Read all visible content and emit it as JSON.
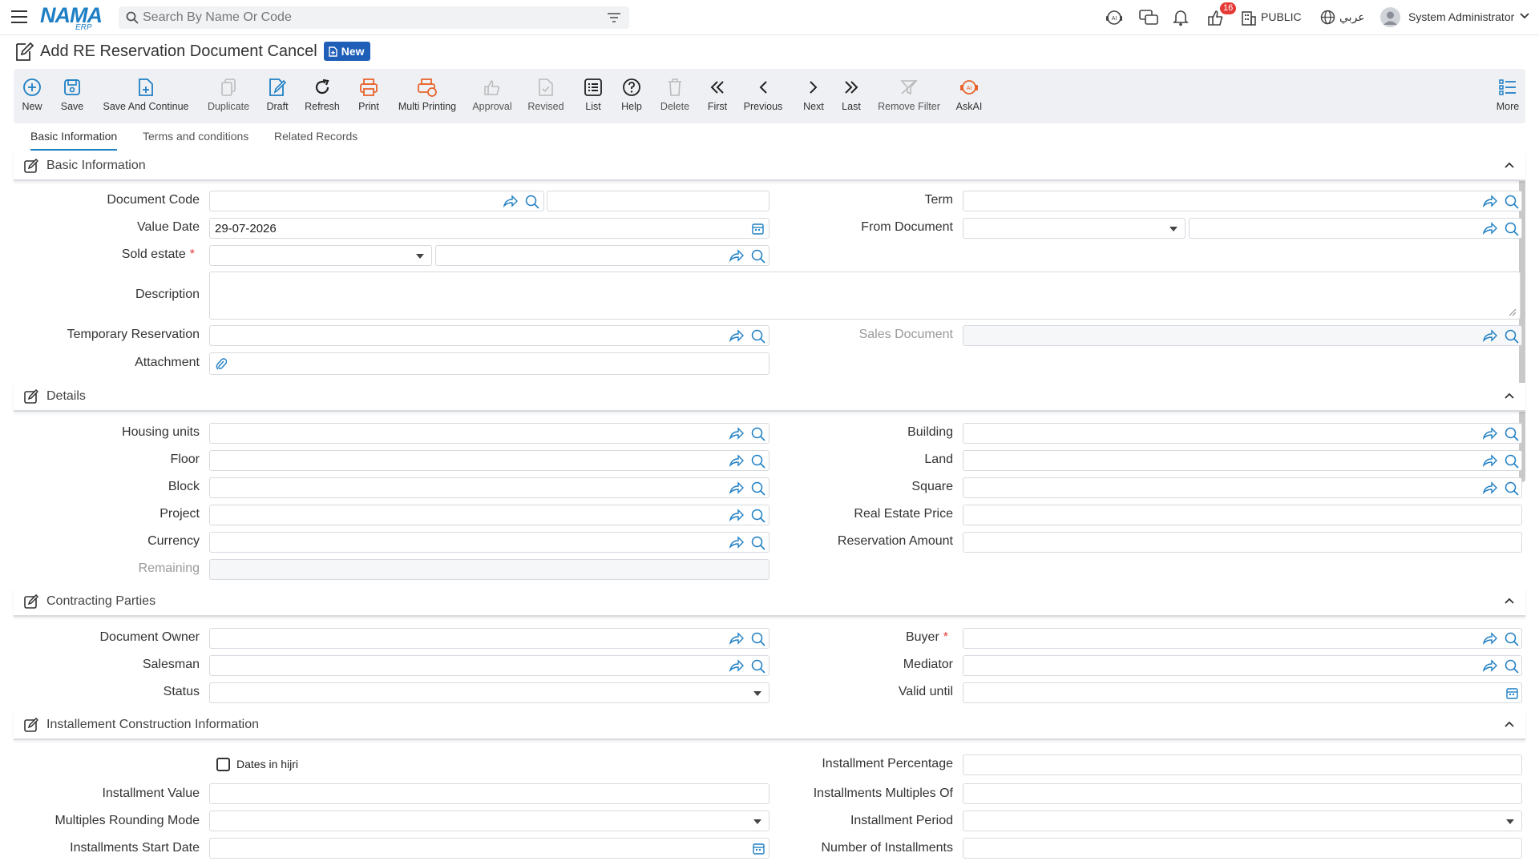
{
  "app": {
    "logo_text": "NAMA",
    "logo_sub": "ERP"
  },
  "search": {
    "placeholder": "Search By Name Or Code"
  },
  "topbar": {
    "notification_count": "16",
    "company": "PUBLIC",
    "language": "عربي",
    "user": "System Administrator"
  },
  "page": {
    "title": "Add RE Reservation Document Cancel",
    "status_badge": "New"
  },
  "toolbar": {
    "new": "New",
    "save": "Save",
    "save_continue": "Save And Continue",
    "duplicate": "Duplicate",
    "draft": "Draft",
    "refresh": "Refresh",
    "print": "Print",
    "multi_printing": "Multi Printing",
    "approval": "Approval",
    "revised": "Revised",
    "list": "List",
    "help": "Help",
    "delete": "Delete",
    "first": "First",
    "previous": "Previous",
    "next": "Next",
    "last": "Last",
    "remove_filter": "Remove Filter",
    "askai": "AskAI",
    "more": "More"
  },
  "tabs": {
    "basic": "Basic Information",
    "terms": "Terms and conditions",
    "related": "Related Records"
  },
  "sections": {
    "basic": "Basic Information",
    "details": "Details",
    "parties": "Contracting Parties",
    "installment": "Installement Construction Information"
  },
  "labels": {
    "document_code": "Document Code",
    "value_date": "Value Date",
    "sold_estate": "Sold estate",
    "description": "Description",
    "temporary_reservation": "Temporary Reservation",
    "attachment": "Attachment",
    "term": "Term",
    "from_document": "From Document",
    "sales_document": "Sales Document",
    "housing_units": "Housing units",
    "floor": "Floor",
    "block": "Block",
    "project": "Project",
    "currency": "Currency",
    "remaining": "Remaining",
    "building": "Building",
    "land": "Land",
    "square": "Square",
    "real_estate_price": "Real Estate Price",
    "reservation_amount": "Reservation Amount",
    "document_owner": "Document Owner",
    "salesman": "Salesman",
    "status": "Status",
    "buyer": "Buyer",
    "mediator": "Mediator",
    "valid_until": "Valid until",
    "dates_in_hijri": "Dates in hijri",
    "installment_value": "Installment Value",
    "multiples_rounding_mode": "Multiples Rounding Mode",
    "installments_start_date": "Installments Start Date",
    "installment_percentage": "Installment Percentage",
    "installments_multiples_of": "Installments Multiples Of",
    "installment_period": "Installment Period",
    "number_of_installments": "Number of Installments",
    "required_mark": "*"
  },
  "values": {
    "value_date": "29-07-2026"
  },
  "colors": {
    "accent": "#1f7fc4",
    "orange": "#e8642c",
    "badge": "#1f5fb8",
    "required": "#e53935"
  }
}
